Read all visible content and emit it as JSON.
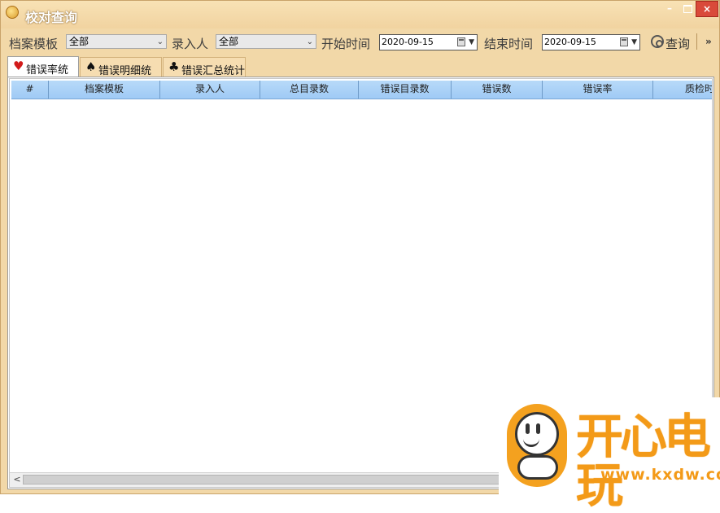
{
  "window": {
    "title": "校对查询",
    "controls": {
      "minimize": "–",
      "maximize": "",
      "close": "×"
    }
  },
  "toolbar": {
    "template_label": "档案模板",
    "template_value": "全部",
    "entrant_label": "录入人",
    "entrant_value": "全部",
    "start_label": "开始时间",
    "start_date": "2020-09-15",
    "end_label": "结束时间",
    "end_date": "2020-09-15",
    "query_label": "查询",
    "more_label": "»"
  },
  "tabs": [
    {
      "icon": "heart-icon",
      "glyph": "♥",
      "label": "错误率统计",
      "active": true
    },
    {
      "icon": "spade-icon",
      "glyph": "♠",
      "label": "错误明细统计",
      "active": false
    },
    {
      "icon": "club-icon",
      "glyph": "♣",
      "label": "错误汇总统计",
      "active": false
    }
  ],
  "table": {
    "columns": [
      "#",
      "档案模板",
      "录入人",
      "总目录数",
      "错误目录数",
      "错误数",
      "错误率",
      "质检时"
    ],
    "rows": []
  },
  "scroll": {
    "left_arrow": "<"
  },
  "watermark": {
    "brand": "开心电玩",
    "url": "www.kxdw.com"
  },
  "colors": {
    "window_bg": "#f2d8a8",
    "grid_header": "#a6cff8",
    "close_button": "#d94a3a",
    "watermark_orange": "#f39a18"
  }
}
